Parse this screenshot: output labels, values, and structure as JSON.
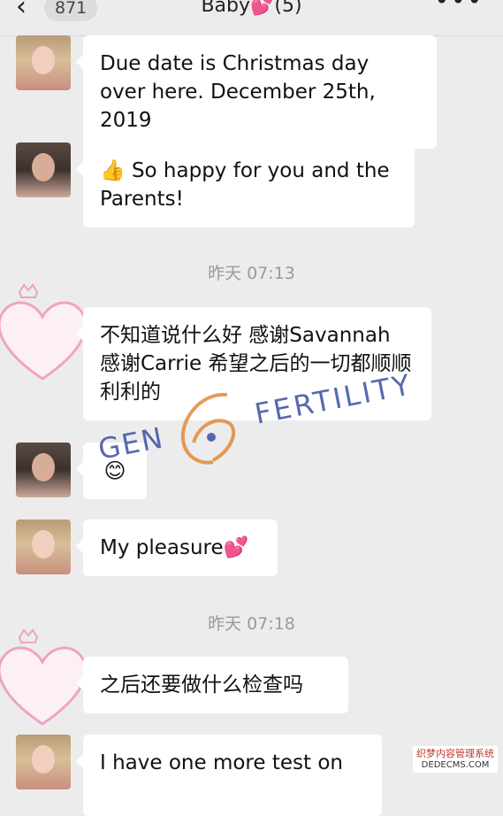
{
  "header": {
    "back_count": "871",
    "title": "Baby💕(5)",
    "more_icon": "more-dots-icon"
  },
  "messages": [
    {
      "sender": "blonde",
      "text": "Due date is Christmas day over here. December 25th, 2019"
    },
    {
      "sender": "brunette",
      "text": "👍 So happy for you and the Parents!"
    },
    {
      "type": "time",
      "text": "昨天 07:13"
    },
    {
      "sender": "heart",
      "text": "不知道说什么好 感谢Savannah 感谢Carrie 希望之后的一切都顺顺利利的"
    },
    {
      "sender": "brunette",
      "text": "😊"
    },
    {
      "sender": "blonde",
      "text": "My pleasure💕"
    },
    {
      "type": "time",
      "text": "昨天 07:18"
    },
    {
      "sender": "heart",
      "text": "之后还要做什么检查吗"
    },
    {
      "sender": "blonde",
      "text": "I have one more test on"
    }
  ],
  "watermark": {
    "left": "GEN",
    "right": "FERTILITY"
  },
  "corner_watermark": {
    "line1": "织梦内容管理系统",
    "line2": "DEDECMS.COM"
  }
}
